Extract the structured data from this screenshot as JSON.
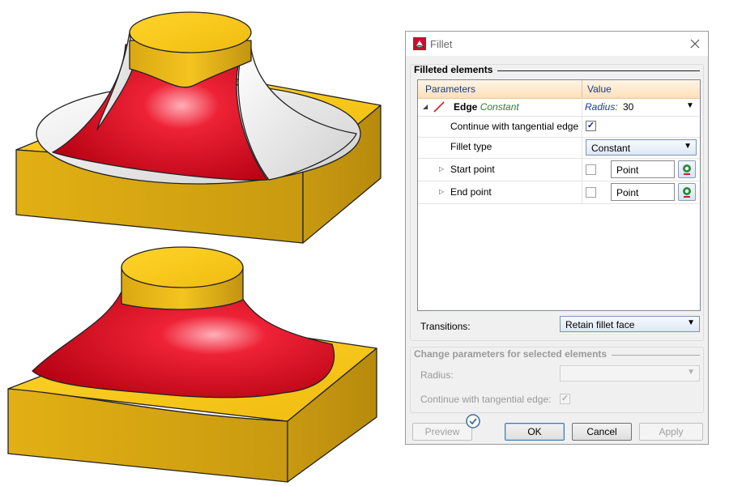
{
  "dialog": {
    "title": "Fillet",
    "filleted_section": "Filleted elements",
    "grid": {
      "col_parameters": "Parameters",
      "col_value": "Value",
      "edge": {
        "label": "Edge",
        "mode": "Constant",
        "value_label": "Radius:",
        "value": "30"
      },
      "tangential": {
        "label": "Continue with tangential edge",
        "checked": true
      },
      "fillet_type": {
        "label": "Fillet type",
        "value": "Constant"
      },
      "start_point": {
        "label": "Start point",
        "checked": false,
        "value": "Point"
      },
      "end_point": {
        "label": "End point",
        "checked": false,
        "value": "Point"
      }
    },
    "transitions": {
      "label": "Transitions:",
      "value": "Retain fillet face"
    },
    "change_section": "Change parameters for selected elements",
    "radius_label": "Radius:",
    "tangential_edge_label": "Continue with tangential edge:",
    "buttons": {
      "preview": "Preview",
      "ok": "OK",
      "cancel": "Cancel",
      "apply": "Apply"
    }
  },
  "colors": {
    "gold": "#f2c020",
    "red": "#e01024",
    "accent": "#1a3aa8"
  },
  "icons": [
    "fillet-app-icon",
    "close-icon",
    "edge-fillet-icon",
    "pick-point-icon",
    "check-badge-icon"
  ]
}
